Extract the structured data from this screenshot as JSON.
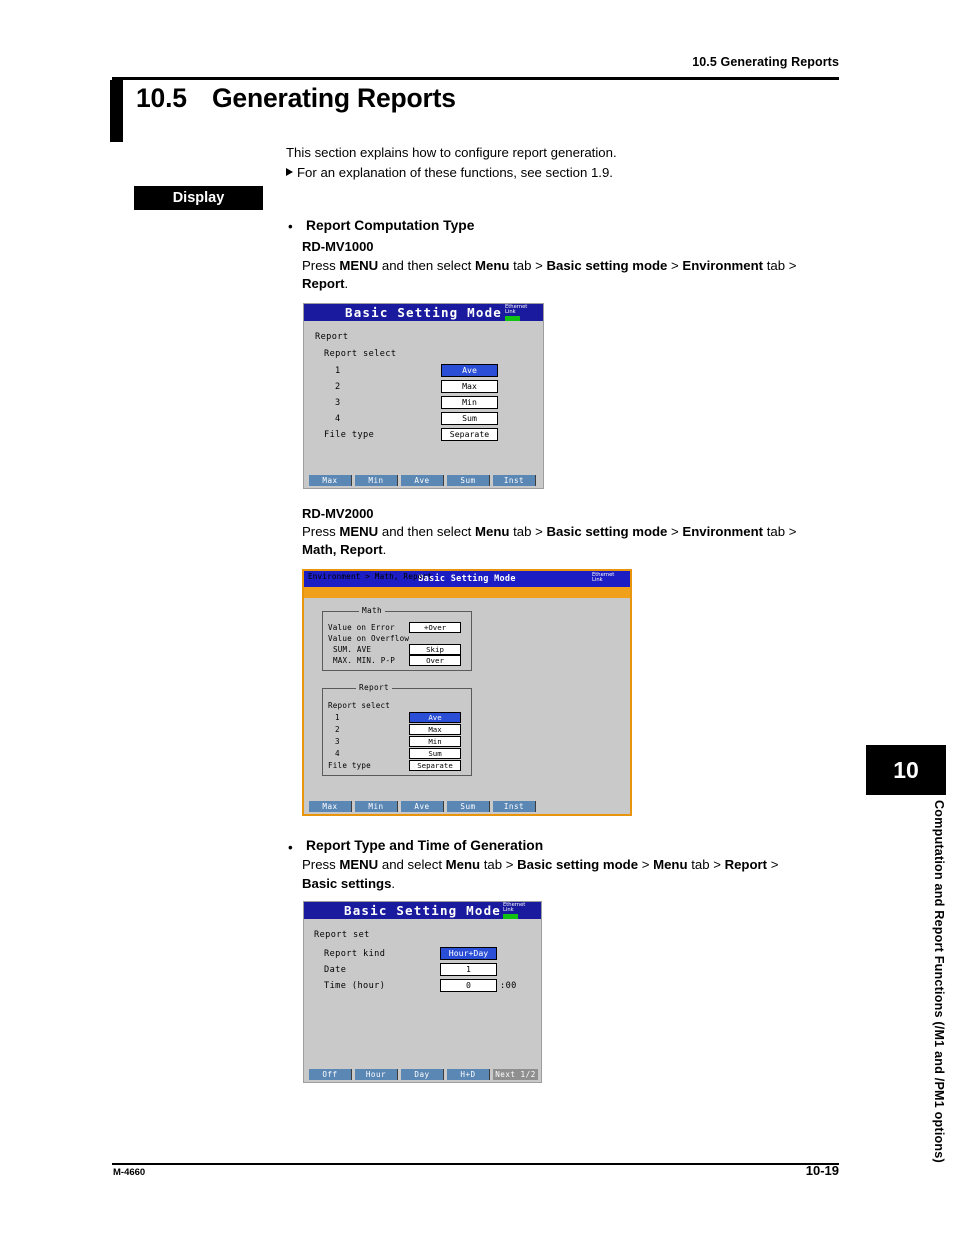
{
  "page": {
    "running_header": "10.5  Generating Reports",
    "section_number": "10.5",
    "section_title": "Generating Reports",
    "intro_line1": "This section explains how to configure report generation.",
    "intro_line2": "For an explanation of these functions, see section 1.9.",
    "display_label": "Display",
    "footer_left": "M-4660",
    "footer_right": "10-19",
    "side_tab_number": "10",
    "side_tab_text": "Computation and Report Functions (/M1 and /PM1 options)"
  },
  "topics": [
    {
      "bullet": "•",
      "heading": "Report Computation Type",
      "model_a": "RD-MV1000",
      "path_a_line1_pre": "Press ",
      "path_a_line1": "Press <b>MENU</b> and then select <b>Menu</b> tab &gt; <b>Basic setting mode</b> &gt; <b>Environment</b> tab &gt;",
      "path_a_line2": "<b>Report</b>.",
      "model_b": "RD-MV2000",
      "path_b_line1": "Press <b>MENU</b> and then select <b>Menu</b> tab &gt; <b>Basic setting mode</b> &gt; <b>Environment</b> tab &gt;",
      "path_b_line2": "<b>Math, Report</b>."
    },
    {
      "bullet": "•",
      "heading": "Report Type and Time of Generation",
      "path_line1": "Press <b>MENU</b> and select <b>Menu</b> tab &gt; <b>Basic setting mode</b> &gt; <b>Menu</b> tab &gt; <b>Report</b> &gt;",
      "path_line2": "<b>Basic settings</b>."
    }
  ],
  "screen_mv1000": {
    "title": "Basic Setting Mode",
    "ethernet_line1": "Ethernet",
    "ethernet_line2": "Link",
    "group_label": "Report",
    "sub_label": "Report select",
    "rows": [
      {
        "label": "1",
        "value": "Ave",
        "selected": true
      },
      {
        "label": "2",
        "value": "Max",
        "selected": false
      },
      {
        "label": "3",
        "value": "Min",
        "selected": false
      },
      {
        "label": "4",
        "value": "Sum",
        "selected": false
      }
    ],
    "file_type_label": "File type",
    "file_type_value": "Separate",
    "function_keys": [
      "Max",
      "Min",
      "Ave",
      "Sum",
      "Inst"
    ]
  },
  "screen_mv2000": {
    "title": "Basic Setting Mode",
    "breadcrumb": "Environment > Math, Report",
    "ethernet_line1": "Ethernet",
    "ethernet_line2": "Link",
    "math_group": {
      "title": "Math",
      "rows": [
        {
          "label": "Value on Error",
          "value": "+Over"
        },
        {
          "label": "Value on Overflow",
          "value": ""
        },
        {
          "label": "SUM. AVE",
          "value": "Skip"
        },
        {
          "label": "MAX. MIN. P-P",
          "value": "Over"
        }
      ]
    },
    "report_group": {
      "title": "Report",
      "sub_label": "Report select",
      "rows": [
        {
          "label": "1",
          "value": "Ave",
          "selected": true
        },
        {
          "label": "2",
          "value": "Max",
          "selected": false
        },
        {
          "label": "3",
          "value": "Min",
          "selected": false
        },
        {
          "label": "4",
          "value": "Sum",
          "selected": false
        }
      ],
      "file_type_label": "File type",
      "file_type_value": "Separate"
    },
    "function_keys": [
      "Max",
      "Min",
      "Ave",
      "Sum",
      "Inst"
    ]
  },
  "screen_report_set": {
    "title": "Basic Setting Mode",
    "ethernet_line1": "Ethernet",
    "ethernet_line2": "Link",
    "group_label": "Report set",
    "rows": [
      {
        "label": "Report kind",
        "value": "Hour+Day",
        "selected": true,
        "suffix": ""
      },
      {
        "label": "Date",
        "value": "1",
        "selected": false,
        "suffix": ""
      },
      {
        "label": "Time (hour)",
        "value": "0",
        "selected": false,
        "suffix": ":00"
      }
    ],
    "function_keys": [
      "Off",
      "Hour",
      "Day",
      "H+D"
    ],
    "next_key": "Next 1/2"
  },
  "colors": {
    "titlebar_blue": "#1a1a9e",
    "selected_blue": "#2a4fd6",
    "breadcrumb_orange": "#f0a01a",
    "screen_grey": "#c9c9c9",
    "fnkey_blue": "#5b87b5",
    "link_lamp_green": "#12c212"
  }
}
